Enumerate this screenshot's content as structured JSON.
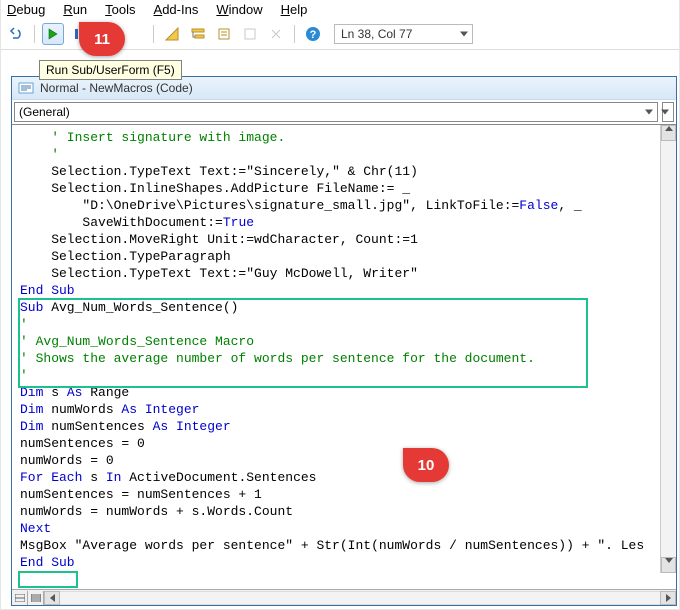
{
  "menus": {
    "debug": "Debug",
    "run": "Run",
    "tools": "Tools",
    "addins": "Add-Ins",
    "window": "Window",
    "help": "Help"
  },
  "toolbar": {
    "cursor_pos": "Ln 38, Col 77"
  },
  "tooltip": "Run Sub/UserForm (F5)",
  "codewin": {
    "title": "Normal - NewMacros (Code)",
    "combo_left": "(General)",
    "combo_right": ""
  },
  "callouts": {
    "c11": "11",
    "c10": "10"
  },
  "code": {
    "l1": "    ' Insert signature with image.",
    "l2": "    '",
    "l3a": "    Selection.TypeText Text:=",
    "l3b": "\"Sincerely,\"",
    "l3c": " & Chr(11)",
    "l4": "    Selection.InlineShapes.AddPicture FileName:= _",
    "l5a": "        ",
    "l5b": "\"D:\\OneDrive\\Pictures\\signature_small.jpg\"",
    "l5c": ", LinkToFile:=",
    "l5d": "False",
    "l5e": ", _",
    "l6a": "        SaveWithDocument:=",
    "l6b": "True",
    "l7": "    Selection.MoveRight Unit:=wdCharacter, Count:=1",
    "l8": "    Selection.TypeParagraph",
    "l9a": "    Selection.TypeText Text:=",
    "l9b": "\"Guy McDowell, Writer\"",
    "l10": "End Sub",
    "l11a": "Sub",
    "l11b": " Avg_Num_Words_Sentence()",
    "l12": "'",
    "l13": "' Avg_Num_Words_Sentence Macro",
    "l14": "' Shows the average number of words per sentence for the document.",
    "l15": "'",
    "l16a": "Dim",
    "l16b": " s ",
    "l16c": "As",
    "l16d": " Range",
    "l17a": "Dim",
    "l17b": " numWords ",
    "l17c": "As Integer",
    "l18a": "Dim",
    "l18b": " numSentences ",
    "l18c": "As Integer",
    "l19": "numSentences = 0",
    "l20": "numWords = 0",
    "l21a": "For Each",
    "l21b": " s ",
    "l21c": "In",
    "l21d": " ActiveDocument.Sentences",
    "l22": "numSentences = numSentences + 1",
    "l23": "numWords = numWords + s.Words.Count",
    "l24": "Next",
    "l25a": "MsgBox ",
    "l25b": "\"Average words per sentence\"",
    "l25c": " + ",
    "l25d": "Str",
    "l25e": "(",
    "l25f": "Int",
    "l25g": "(numWords / numSentences)) + ",
    "l25h": "\". Les",
    "l26": "End Sub"
  }
}
